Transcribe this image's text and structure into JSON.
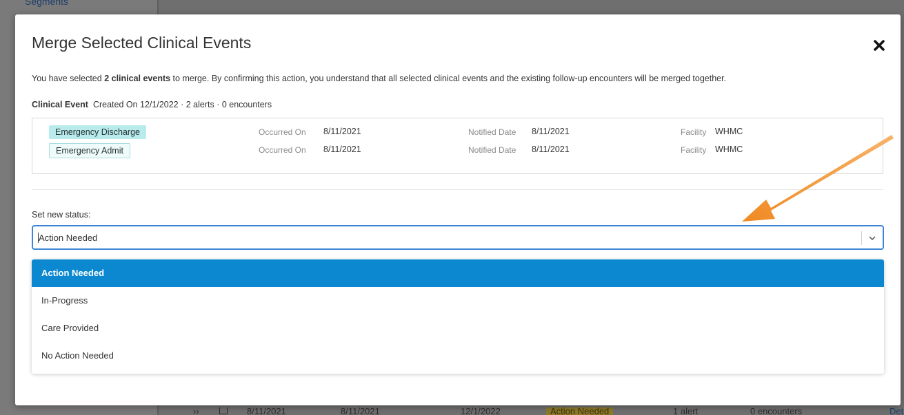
{
  "background": {
    "sidebar_link": "Segments",
    "row": {
      "date1": "8/11/2021",
      "date2": "8/11/2021",
      "date3": "12/1/2022",
      "status": "Action Needed",
      "alerts": "1 alert",
      "encounters": "0 encounters",
      "details": "Details"
    }
  },
  "modal": {
    "title": "Merge Selected Clinical Events",
    "close_icon": "close-icon",
    "intro": {
      "prefix": "You have selected ",
      "bold": "2 clinical events",
      "suffix": " to merge. By confirming this action, you understand that all selected clinical events and the existing follow-up encounters will be merged together."
    },
    "event_summary": {
      "label": "Clinical Event",
      "details": "Created On 12/1/2022 · 2 alerts · 0 encounters"
    },
    "events": [
      {
        "type": "Emergency Discharge",
        "occurred_label": "Occurred On",
        "occurred": "8/11/2021",
        "notified_label": "Notified Date",
        "notified": "8/11/2021",
        "facility_label": "Facility",
        "facility": "WHMC"
      },
      {
        "type": "Emergency Admit",
        "occurred_label": "Occurred On",
        "occurred": "8/11/2021",
        "notified_label": "Notified Date",
        "notified": "8/11/2021",
        "facility_label": "Facility",
        "facility": "WHMC"
      }
    ],
    "status": {
      "label": "Set new status:",
      "value": "Action Needed",
      "options": [
        "Action Needed",
        "In-Progress",
        "Care Provided",
        "No Action Needed"
      ],
      "selected_index": 0
    }
  },
  "colors": {
    "accent": "#0b88d0",
    "focus_border": "#3d86d6",
    "tag_filled": "#b9eaec",
    "annotation_arrow": "#f08a24"
  }
}
